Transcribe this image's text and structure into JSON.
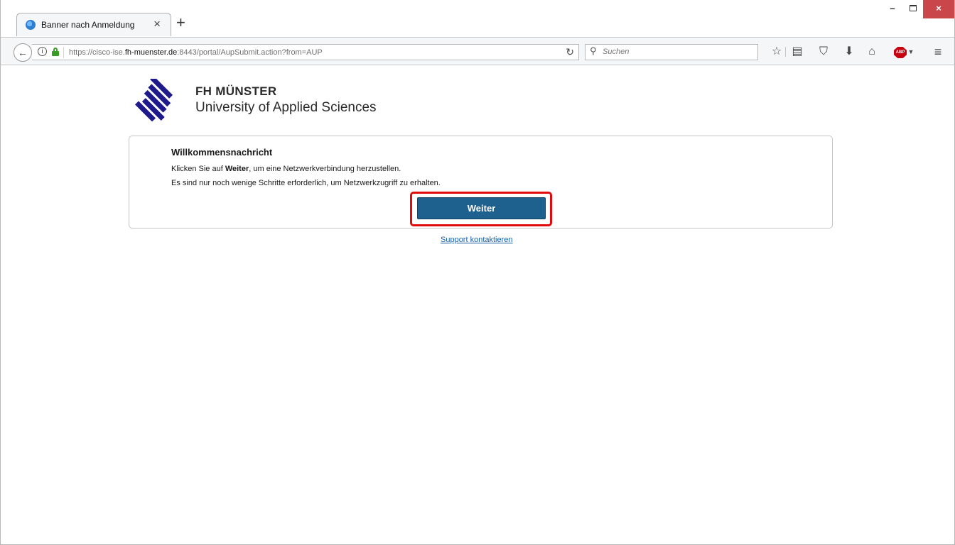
{
  "browser": {
    "tab_title": "Banner nach Anmeldung",
    "tab_close": "×",
    "new_tab": "+",
    "window_controls": {
      "minimize": "–",
      "close": "×"
    },
    "url_host_prefix": "https://cisco-ise.",
    "url_host_domain": "fh-muenster.de",
    "url_path": ":8443/portal/AupSubmit.action?from=AUP",
    "search_placeholder": "Suchen",
    "icons": {
      "back": "back-arrow-icon",
      "info": "info-icon",
      "lock": "lock-icon",
      "reload": "reload-icon",
      "search": "search-icon",
      "bookmark": "star-icon",
      "reader": "reader-list-icon",
      "pocket": "pocket-icon",
      "download": "download-icon",
      "home": "home-icon",
      "adblock": "adblock-plus-icon",
      "menu": "hamburger-menu-icon"
    },
    "adblock_label": "ABP"
  },
  "page": {
    "brand_title": "FH MÜNSTER",
    "brand_subtitle": "University of Applied Sciences",
    "card": {
      "heading": "Willkommensnachricht",
      "line1_prefix": "Klicken Sie auf ",
      "line1_bold": "Weiter",
      "line1_suffix": ", um eine Netzwerkverbindung herzustellen.",
      "line2": "Es sind nur noch wenige Schritte erforderlich, um Netzwerkzugriff zu erhalten.",
      "button_label": "Weiter"
    },
    "support_link": "Support kontaktieren"
  },
  "colors": {
    "brand_navy": "#1f1a8c",
    "button": "#1e618f",
    "highlight": "#e10b0b",
    "link": "#1a5fa8",
    "close_button": "#c9464a"
  }
}
